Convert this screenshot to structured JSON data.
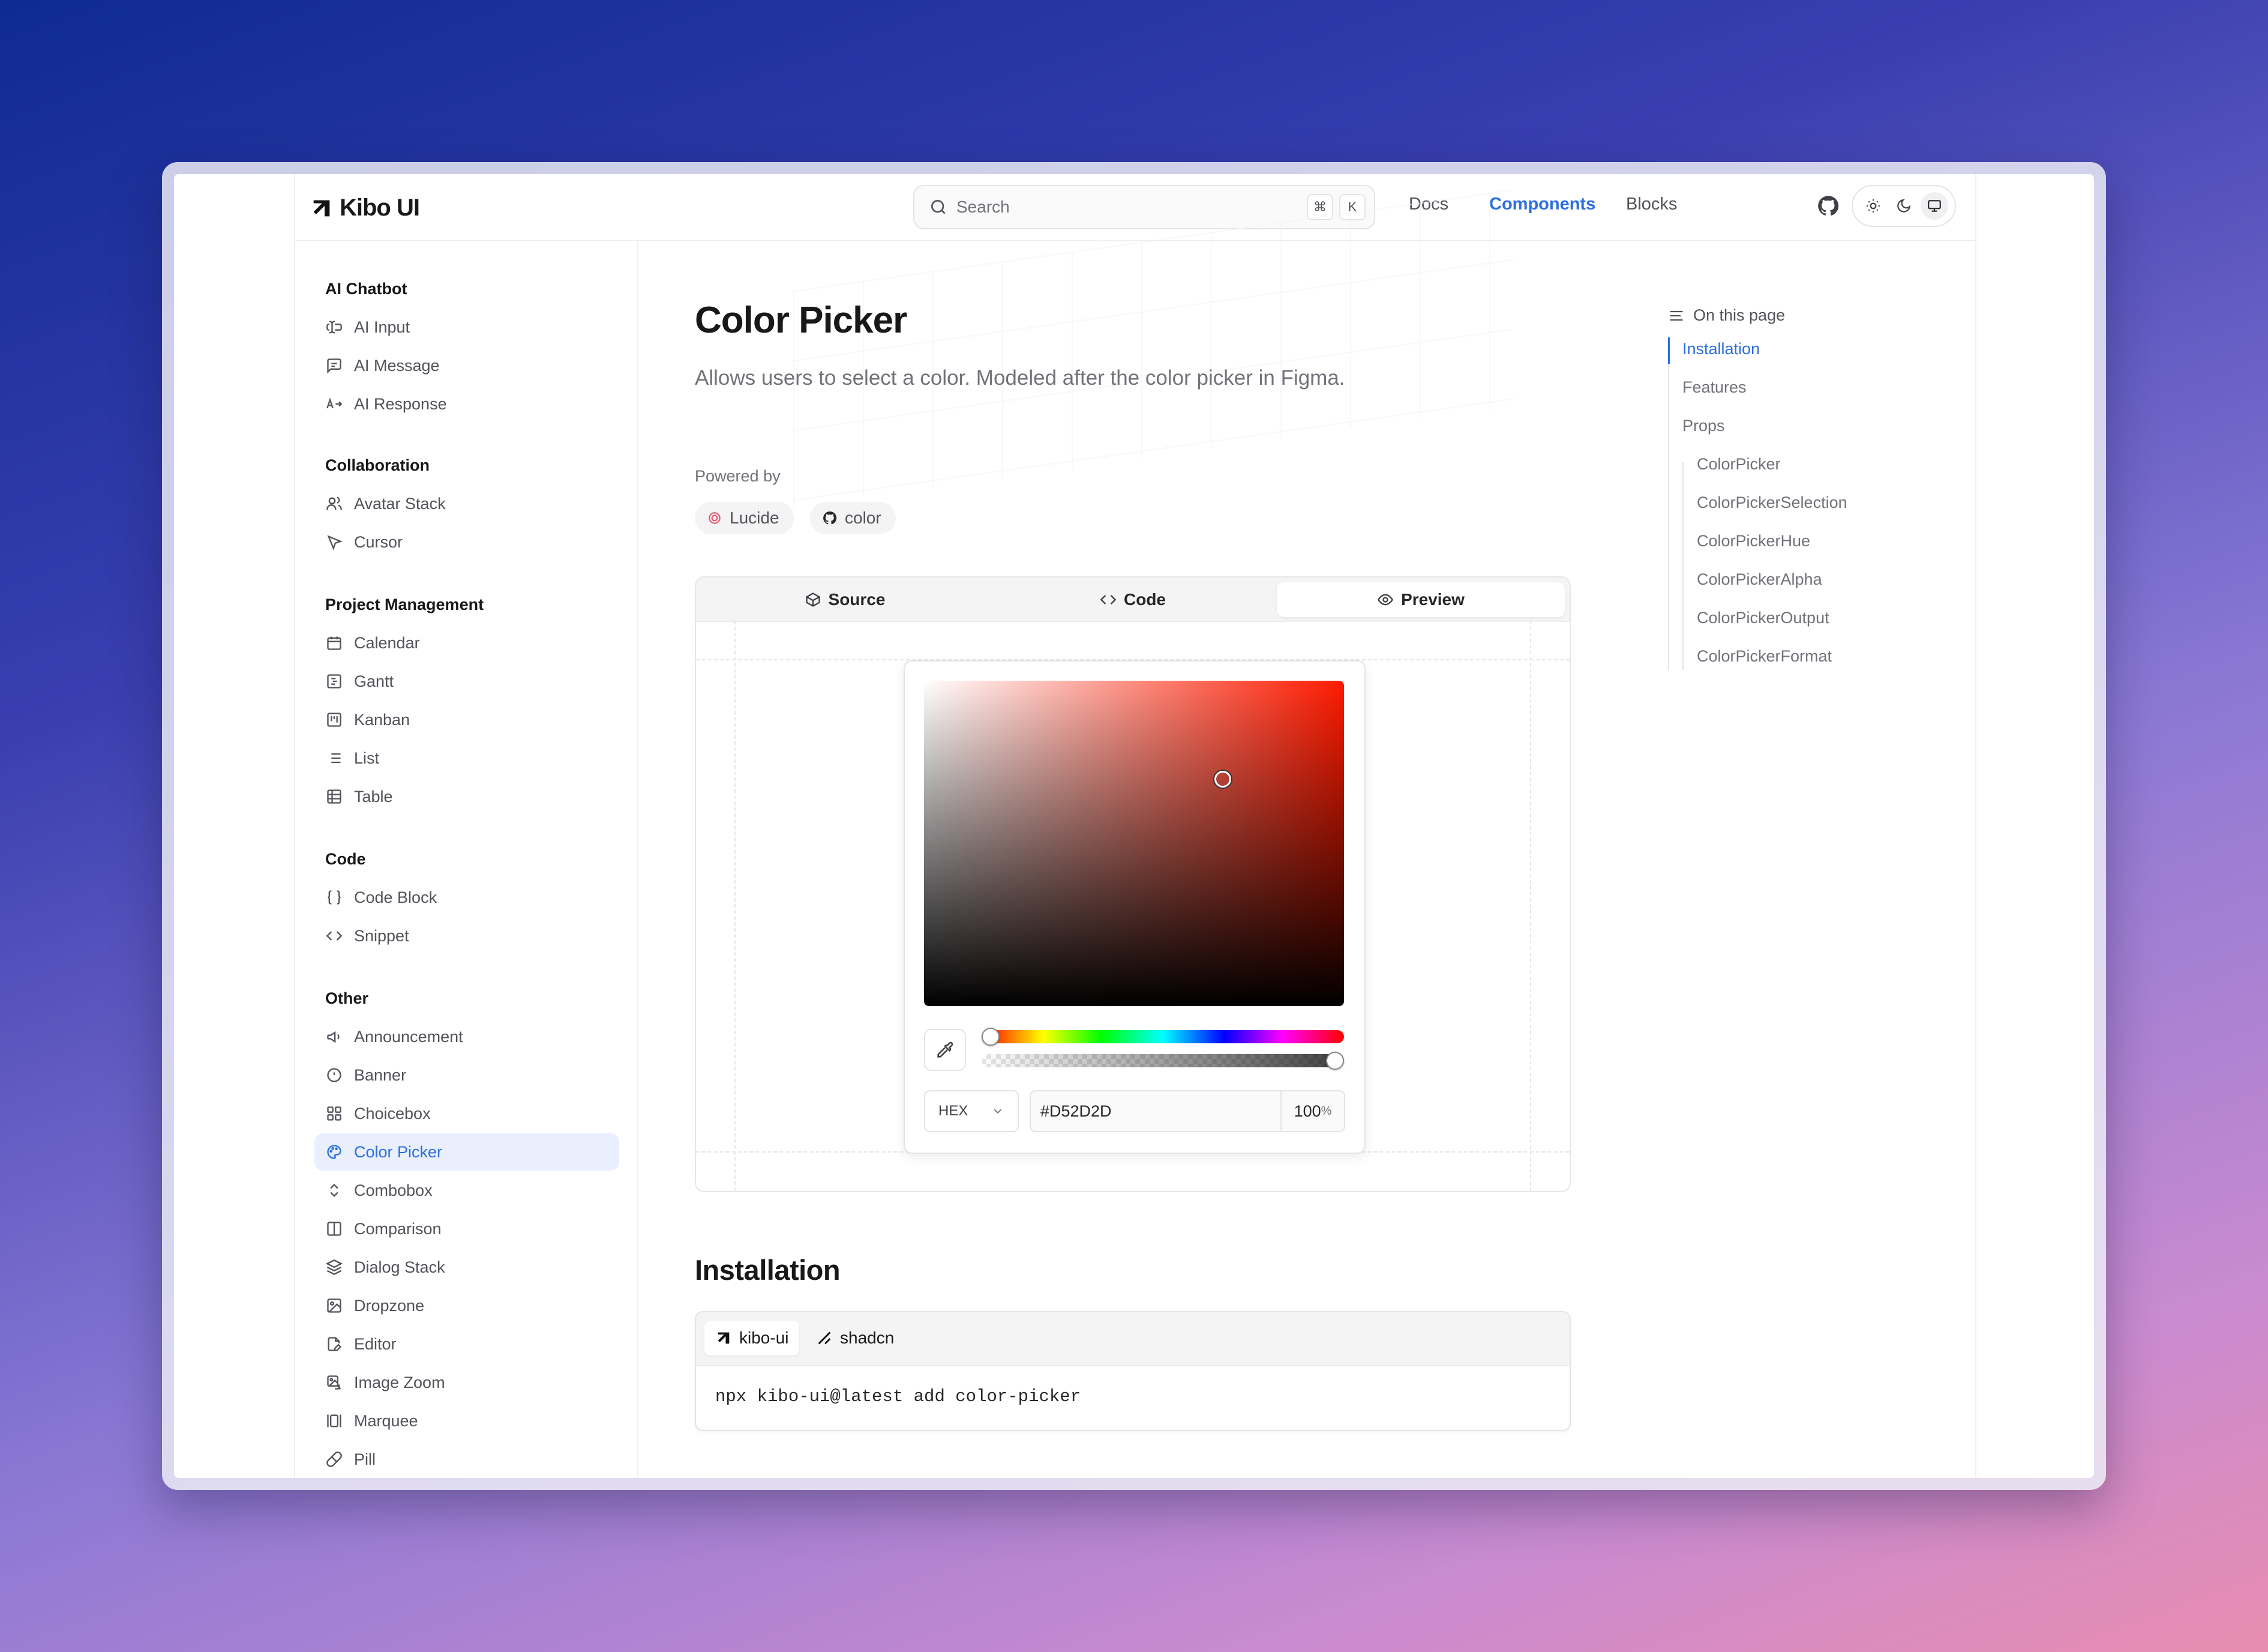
{
  "brand": {
    "name": "Kibo UI"
  },
  "search": {
    "placeholder": "Search",
    "kbd_cmd": "⌘",
    "kbd_key": "K"
  },
  "topnav": {
    "docs": "Docs",
    "components": "Components",
    "blocks": "Blocks"
  },
  "sidebar": {
    "sections": [
      {
        "title": "AI Chatbot",
        "items": [
          "AI Input",
          "AI Message",
          "AI Response"
        ]
      },
      {
        "title": "Collaboration",
        "items": [
          "Avatar Stack",
          "Cursor"
        ]
      },
      {
        "title": "Project Management",
        "items": [
          "Calendar",
          "Gantt",
          "Kanban",
          "List",
          "Table"
        ]
      },
      {
        "title": "Code",
        "items": [
          "Code Block",
          "Snippet"
        ]
      },
      {
        "title": "Other",
        "items": [
          "Announcement",
          "Banner",
          "Choicebox",
          "Color Picker",
          "Combobox",
          "Comparison",
          "Dialog Stack",
          "Dropzone",
          "Editor",
          "Image Zoom",
          "Marquee",
          "Pill"
        ]
      }
    ],
    "active": "Color Picker"
  },
  "page": {
    "title": "Color Picker",
    "lead": "Allows users to select a color. Modeled after the color picker in Figma.",
    "powered_by": "Powered by",
    "chips": [
      "Lucide",
      "color"
    ]
  },
  "preview": {
    "tabs": [
      "Source",
      "Code",
      "Preview"
    ],
    "active_tab": "Preview",
    "picker": {
      "format": "HEX",
      "hex_value": "#D52D2D",
      "alpha_value": "100",
      "alpha_unit": "%",
      "hue_position": 0.0,
      "alpha_position": 1.0
    }
  },
  "installation": {
    "heading": "Installation",
    "tabs": [
      "kibo-ui",
      "shadcn"
    ],
    "command": "npx kibo-ui@latest add color-picker"
  },
  "toc": {
    "heading": "On this page",
    "items": [
      "Installation",
      "Features",
      "Props"
    ],
    "sub_items": [
      "ColorPicker",
      "ColorPickerSelection",
      "ColorPickerHue",
      "ColorPickerAlpha",
      "ColorPickerOutput",
      "ColorPickerFormat"
    ],
    "active": "Installation"
  },
  "colors": {
    "accent": "#2b6ee0",
    "selected_color": "#D52D2D"
  }
}
